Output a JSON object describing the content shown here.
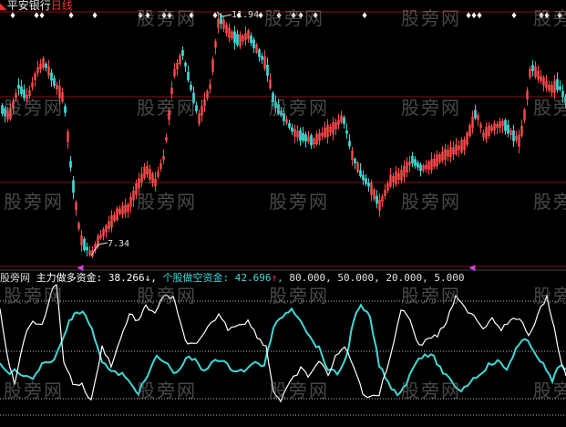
{
  "header": {
    "stock_name": "平安银行",
    "period": "日线"
  },
  "price_panel": {
    "high_label": "11.94",
    "low_label": "7.34"
  },
  "indicator": {
    "name": "股旁网",
    "main_label": "主力做多资金:",
    "main_value": "38.266",
    "main_arrow": "↓",
    "retail_label": "个股做空资金:",
    "retail_value": "42.696",
    "retail_arrow": "↑",
    "levels": [
      "80.000",
      "50.000",
      "20.000",
      "5.000"
    ]
  },
  "watermark": "股旁网",
  "colors": {
    "background": "#000000",
    "up_candle": "#ff4b4b",
    "down_candle": "#40d8d8",
    "long_line": "#ffffff",
    "short_line": "#40d8d8",
    "grid": "#8a1010",
    "marker": "#ffffff",
    "marker_arrow": "#d040e0"
  }
}
